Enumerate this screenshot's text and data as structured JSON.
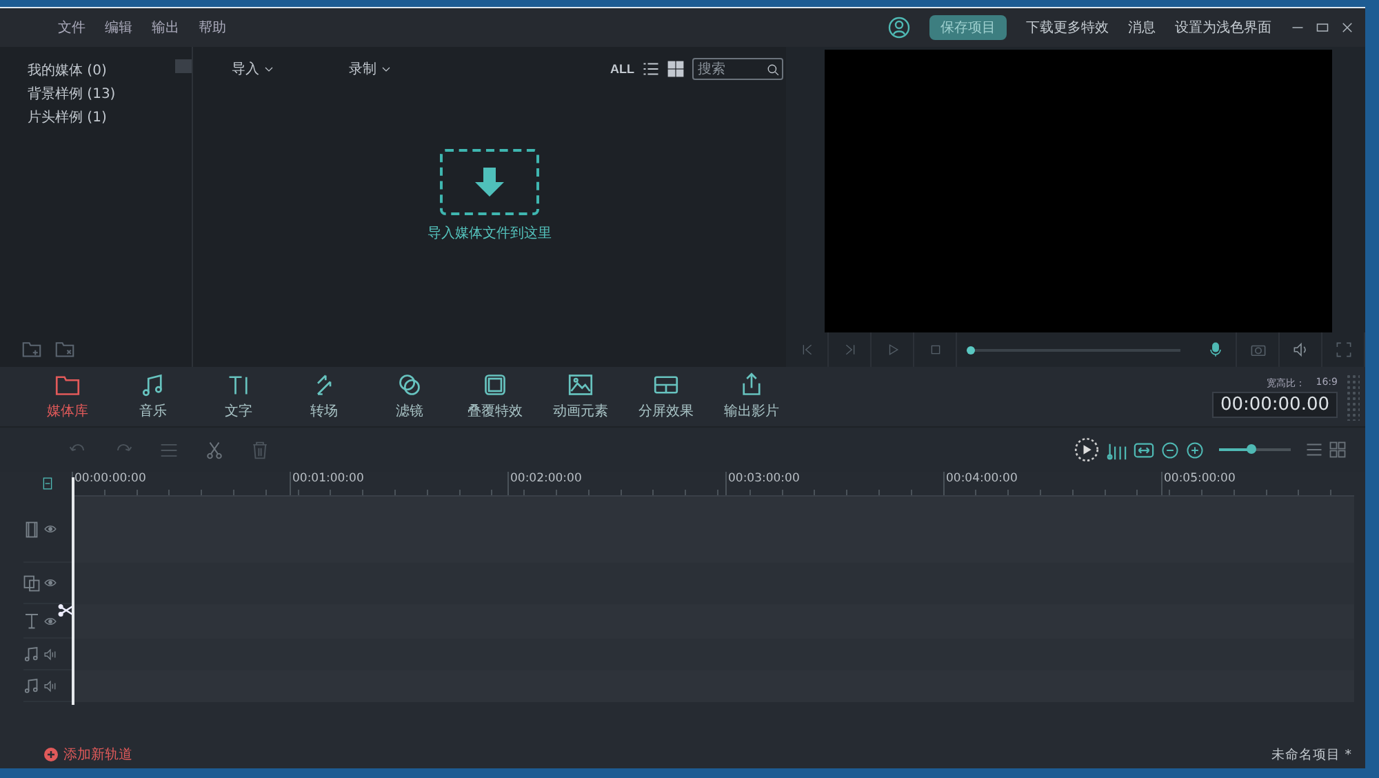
{
  "menu": [
    "文件",
    "编辑",
    "输出",
    "帮助"
  ],
  "title_actions": {
    "save": "保存项目",
    "links": [
      "下载更多特效",
      "消息",
      "设置为浅色界面"
    ]
  },
  "media": {
    "sidebar": [
      "我的媒体 (0)",
      "背景样例 (13)",
      "片头样例 (1)"
    ],
    "import": "导入",
    "record": "录制",
    "filter_all": "ALL",
    "search": {
      "placeholder": "搜索"
    },
    "drop_hint": "导入媒体文件到这里"
  },
  "player": {
    "level": 0.0
  },
  "tools": [
    {
      "label": "媒体库",
      "kind": "folder",
      "selected": true
    },
    {
      "label": "音乐",
      "kind": "music",
      "selected": false
    },
    {
      "label": "文字",
      "kind": "text",
      "selected": false
    },
    {
      "label": "转场",
      "kind": "transition",
      "selected": false
    },
    {
      "label": "滤镜",
      "kind": "filter",
      "selected": false
    },
    {
      "label": "叠覆特效",
      "kind": "overlay",
      "selected": false
    },
    {
      "label": "动画元素",
      "kind": "image",
      "selected": false
    },
    {
      "label": "分屏效果",
      "kind": "split",
      "selected": false
    },
    {
      "label": "输出影片",
      "kind": "export",
      "selected": false
    }
  ],
  "aspect": {
    "label": "宽高比：",
    "value": "16:9"
  },
  "timecode": "00:00:00.00",
  "timeline": {
    "zoom": {
      "level": 0.45
    },
    "ruler": [
      "00:00:00:00",
      "00:01:00:00",
      "00:02:00:00",
      "00:03:00:00",
      "00:04:00:00",
      "00:05:00:00"
    ],
    "tracks": [
      {
        "kind": "video"
      },
      {
        "kind": "overlay"
      },
      {
        "kind": "text"
      },
      {
        "kind": "audio"
      },
      {
        "kind": "audio"
      }
    ]
  },
  "status": {
    "add_track": "添加新轨道",
    "project": "未命名项目 *"
  }
}
